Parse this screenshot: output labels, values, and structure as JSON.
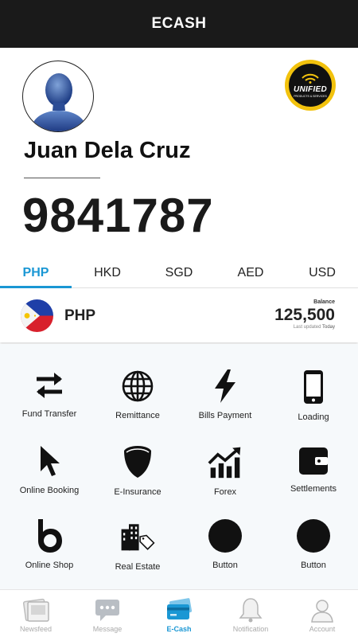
{
  "header": {
    "title": "ECASH"
  },
  "profile": {
    "avatar_icon": "user-avatar-icon",
    "logo": {
      "text": "UNIFIED",
      "subtext": "PRODUCTS & SERVICES"
    },
    "name": "Juan Dela Cruz",
    "account_number": "9841787"
  },
  "currency_tabs": [
    {
      "label": "PHP",
      "active": true
    },
    {
      "label": "HKD",
      "active": false
    },
    {
      "label": "SGD",
      "active": false
    },
    {
      "label": "AED",
      "active": false
    },
    {
      "label": "USD",
      "active": false
    }
  ],
  "balance": {
    "currency": "PHP",
    "flag_icon": "philippines-flag-icon",
    "label": "Balance",
    "value": "125,500",
    "updated_label": "Last updated",
    "updated_value": "Today"
  },
  "services": [
    {
      "label": "Fund Transfer",
      "icon": "transfer-arrows-icon"
    },
    {
      "label": "Remittance",
      "icon": "globe-icon"
    },
    {
      "label": "Bills Payment",
      "icon": "lightning-icon"
    },
    {
      "label": "Loading",
      "icon": "mobile-phone-icon"
    },
    {
      "label": "Online Booking",
      "icon": "cursor-icon"
    },
    {
      "label": "E-Insurance",
      "icon": "shield-icon"
    },
    {
      "label": "Forex",
      "icon": "growth-chart-icon"
    },
    {
      "label": "Settlements",
      "icon": "wallet-icon"
    },
    {
      "label": "Online Shop",
      "icon": "b-logo-icon"
    },
    {
      "label": "Real Estate",
      "icon": "building-tag-icon"
    },
    {
      "label": "Button",
      "icon": "circle-icon"
    },
    {
      "label": "Button",
      "icon": "circle-icon"
    }
  ],
  "bottom_nav": [
    {
      "label": "Newsfeed",
      "icon": "newsfeed-icon",
      "active": false
    },
    {
      "label": "Message",
      "icon": "message-bubble-icon",
      "active": false
    },
    {
      "label": "E-Cash",
      "icon": "credit-card-icon",
      "active": true
    },
    {
      "label": "Notification",
      "icon": "bell-icon",
      "active": false
    },
    {
      "label": "Account",
      "icon": "account-icon",
      "active": false
    }
  ],
  "colors": {
    "accent": "#1a97d4",
    "topbar": "#1a1a1a",
    "grid_bg": "#f6f9fb",
    "logo_gold": "#f2c20d"
  }
}
